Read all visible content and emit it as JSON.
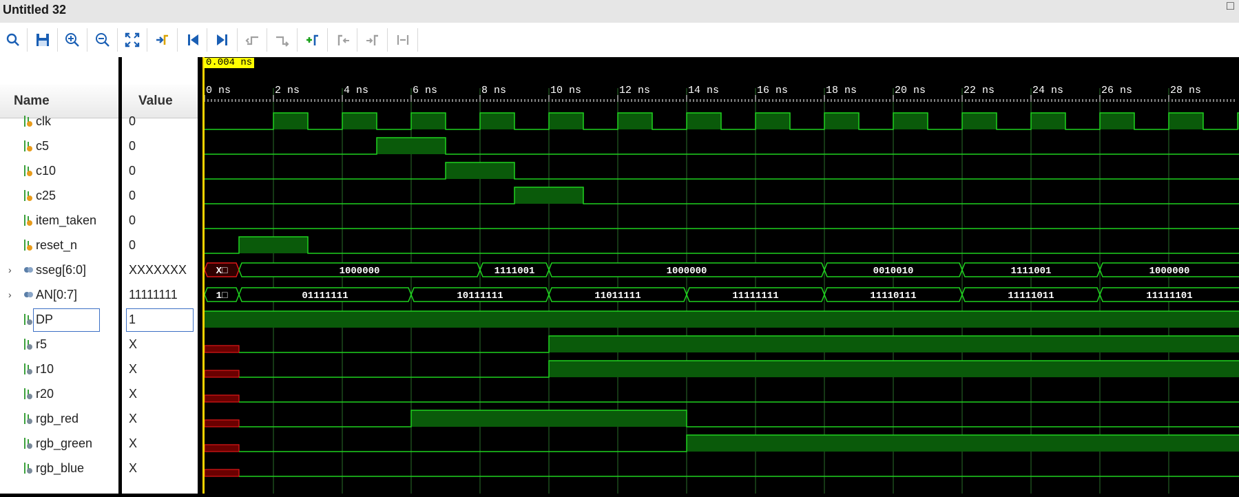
{
  "window": {
    "title": "Untitled 32",
    "maximize_glyph": "□"
  },
  "toolbar": {
    "buttons": [
      {
        "name": "search-icon",
        "enabled": true
      },
      {
        "name": "save-icon",
        "enabled": true
      },
      {
        "name": "zoom-in-icon",
        "enabled": true
      },
      {
        "name": "zoom-out-icon",
        "enabled": true
      },
      {
        "name": "zoom-fit-icon",
        "enabled": true
      },
      {
        "name": "go-to-cursor-icon",
        "enabled": true
      },
      {
        "name": "go-to-time-zero-icon",
        "enabled": true
      },
      {
        "name": "go-to-last-time-icon",
        "enabled": true
      },
      {
        "name": "previous-transition-icon",
        "enabled": false
      },
      {
        "name": "next-transition-icon",
        "enabled": false
      },
      {
        "name": "add-marker-icon",
        "enabled": true
      },
      {
        "name": "previous-marker-icon",
        "enabled": false
      },
      {
        "name": "next-marker-icon",
        "enabled": false
      },
      {
        "name": "swap-cursors-icon",
        "enabled": false
      }
    ]
  },
  "columns": {
    "name": "Name",
    "value": "Value"
  },
  "cursor": {
    "label": "0.004 ns",
    "time_ns": 0.004
  },
  "timeline": {
    "ticks": [
      "0 ns",
      "2 ns",
      "4 ns",
      "6 ns",
      "8 ns",
      "10 ns",
      "12 ns",
      "14 ns",
      "16 ns",
      "18 ns",
      "20 ns",
      "22 ns",
      "24 ns",
      "26 ns",
      "28 ns"
    ],
    "tick_values_ns": [
      0,
      2,
      4,
      6,
      8,
      10,
      12,
      14,
      16,
      18,
      20,
      22,
      24,
      26,
      28
    ],
    "view_end_ns": 30.2
  },
  "colors": {
    "waveform": "#1fd21f",
    "waveform_fill": "#0a5a0a",
    "unknown": "#e01818",
    "unknown_fill": "#6a0000",
    "cursor": "#ffd400",
    "grid": "#2a6f2a",
    "background": "#000000"
  },
  "signals": [
    {
      "name": "clk",
      "value": "0",
      "kind": "in",
      "edges": [
        [
          0,
          0
        ],
        [
          2,
          1
        ],
        [
          3,
          0
        ],
        [
          4,
          1
        ],
        [
          5,
          0
        ],
        [
          6,
          1
        ],
        [
          7,
          0
        ],
        [
          8,
          1
        ],
        [
          9,
          0
        ],
        [
          10,
          1
        ],
        [
          11,
          0
        ],
        [
          12,
          1
        ],
        [
          13,
          0
        ],
        [
          14,
          1
        ],
        [
          15,
          0
        ],
        [
          16,
          1
        ],
        [
          17,
          0
        ],
        [
          18,
          1
        ],
        [
          19,
          0
        ],
        [
          20,
          1
        ],
        [
          21,
          0
        ],
        [
          22,
          1
        ],
        [
          23,
          0
        ],
        [
          24,
          1
        ],
        [
          25,
          0
        ],
        [
          26,
          1
        ],
        [
          27,
          0
        ],
        [
          28,
          1
        ],
        [
          29,
          0
        ],
        [
          30,
          1
        ]
      ]
    },
    {
      "name": "c5",
      "value": "0",
      "kind": "in",
      "edges": [
        [
          0,
          0
        ],
        [
          5,
          1
        ],
        [
          7,
          0
        ]
      ]
    },
    {
      "name": "c10",
      "value": "0",
      "kind": "in",
      "edges": [
        [
          0,
          0
        ],
        [
          7,
          1
        ],
        [
          9,
          0
        ]
      ]
    },
    {
      "name": "c25",
      "value": "0",
      "kind": "in",
      "edges": [
        [
          0,
          0
        ],
        [
          9,
          1
        ],
        [
          11,
          0
        ]
      ]
    },
    {
      "name": "item_taken",
      "value": "0",
      "kind": "in",
      "edges": [
        [
          0,
          0
        ]
      ]
    },
    {
      "name": "reset_n",
      "value": "0",
      "kind": "in",
      "edges": [
        [
          0,
          0
        ],
        [
          1,
          1
        ],
        [
          3,
          0
        ]
      ]
    },
    {
      "name": "sseg[6:0]",
      "value": "XXXXXXX",
      "kind": "bus",
      "expandable": true,
      "segments": [
        {
          "t": 0,
          "label": "X□",
          "x": true
        },
        {
          "t": 1,
          "label": "1000000"
        },
        {
          "t": 8,
          "label": "1111001"
        },
        {
          "t": 10,
          "label": "1000000"
        },
        {
          "t": 18,
          "label": "0010010"
        },
        {
          "t": 22,
          "label": "1111001"
        },
        {
          "t": 26,
          "label": "1000000"
        }
      ]
    },
    {
      "name": "AN[0:7]",
      "value": "11111111",
      "kind": "bus",
      "expandable": true,
      "segments": [
        {
          "t": 0,
          "label": "1□"
        },
        {
          "t": 1,
          "label": "01111111"
        },
        {
          "t": 6,
          "label": "10111111"
        },
        {
          "t": 10,
          "label": "11011111"
        },
        {
          "t": 14,
          "label": "11111111"
        },
        {
          "t": 18,
          "label": "11110111"
        },
        {
          "t": 22,
          "label": "11111011"
        },
        {
          "t": 26,
          "label": "11111101"
        }
      ]
    },
    {
      "name": "DP",
      "value": "1",
      "kind": "out",
      "selected": true,
      "edges": [
        [
          0,
          1
        ]
      ]
    },
    {
      "name": "r5",
      "value": "X",
      "kind": "out",
      "edges": [
        [
          0,
          "x"
        ],
        [
          1,
          0
        ],
        [
          10,
          1
        ]
      ]
    },
    {
      "name": "r10",
      "value": "X",
      "kind": "out",
      "edges": [
        [
          0,
          "x"
        ],
        [
          1,
          0
        ],
        [
          10,
          1
        ]
      ]
    },
    {
      "name": "r20",
      "value": "X",
      "kind": "out",
      "edges": [
        [
          0,
          "x"
        ],
        [
          1,
          0
        ]
      ]
    },
    {
      "name": "rgb_red",
      "value": "X",
      "kind": "out",
      "edges": [
        [
          0,
          "x"
        ],
        [
          1,
          0
        ],
        [
          6,
          1
        ],
        [
          14,
          0
        ]
      ]
    },
    {
      "name": "rgb_green",
      "value": "X",
      "kind": "out",
      "edges": [
        [
          0,
          "x"
        ],
        [
          1,
          0
        ],
        [
          14,
          1
        ]
      ]
    },
    {
      "name": "rgb_blue",
      "value": "X",
      "kind": "out",
      "edges": [
        [
          0,
          "x"
        ],
        [
          1,
          0
        ]
      ]
    }
  ]
}
